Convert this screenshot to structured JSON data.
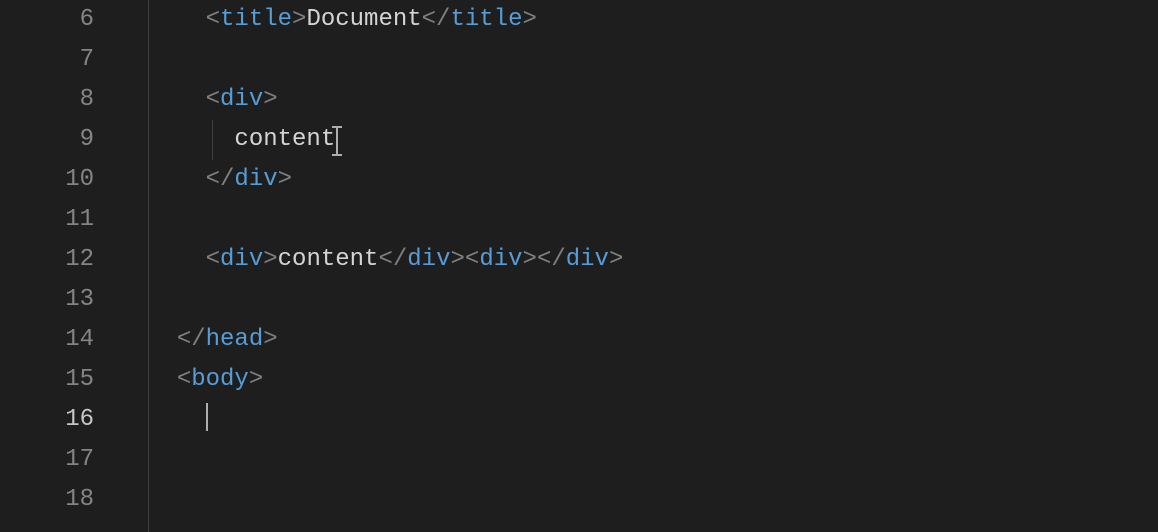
{
  "gutter": {
    "start": 6,
    "count": 13,
    "activeLine": 16
  },
  "code": {
    "line6": {
      "indent": "    ",
      "open": "<",
      "tag1": "title",
      "close1": ">",
      "text": "Document",
      "open2": "</",
      "tag2": "title",
      "close2": ">"
    },
    "line8": {
      "indent": "    ",
      "open": "<",
      "tag": "div",
      "close": ">"
    },
    "line9": {
      "indent": "      ",
      "text": "content"
    },
    "line10": {
      "indent": "    ",
      "open": "</",
      "tag": "div",
      "close": ">"
    },
    "line12": {
      "indent": "    ",
      "open1": "<",
      "tag1": "div",
      "close1": ">",
      "text": "content",
      "open2": "</",
      "tag2": "div",
      "close2": ">",
      "open3": "<",
      "tag3": "div",
      "close3": ">",
      "open4": "</",
      "tag4": "div",
      "close4": ">"
    },
    "line14": {
      "indent": "  ",
      "open": "</",
      "tag": "head",
      "close": ">"
    },
    "line15": {
      "indent": "  ",
      "open": "<",
      "tag": "body",
      "close": ">"
    }
  }
}
